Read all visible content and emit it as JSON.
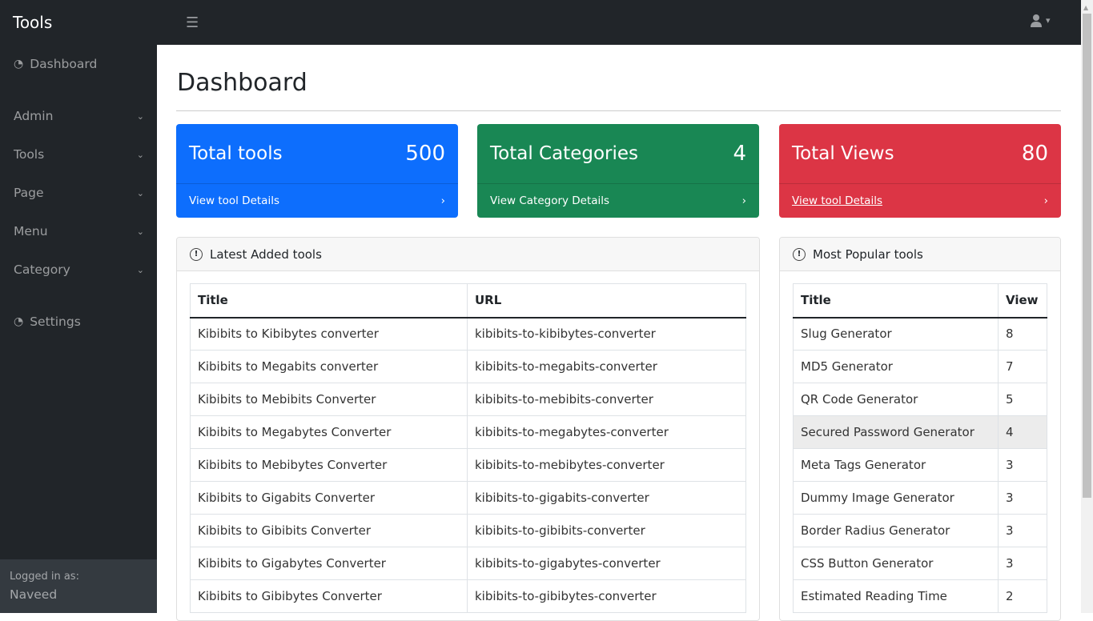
{
  "topbar": {
    "brand": "Tools",
    "menu_icon": "☰",
    "user_icon": "👤",
    "caret": "▾"
  },
  "sidebar": {
    "items": [
      {
        "label": "Dashboard",
        "icon": "gauge-icon"
      },
      {
        "label": "Admin"
      },
      {
        "label": "Tools"
      },
      {
        "label": "Page"
      },
      {
        "label": "Menu"
      },
      {
        "label": "Category"
      },
      {
        "label": "Settings",
        "icon": "gauge-icon"
      }
    ],
    "footer": {
      "label": "Logged in as:",
      "user": "Naveed"
    }
  },
  "page": {
    "title": "Dashboard"
  },
  "cards": [
    {
      "title": "Total tools",
      "value": "500",
      "link": "View tool Details",
      "color": "#0d6efd"
    },
    {
      "title": "Total Categories",
      "value": "4",
      "link": "View Category Details",
      "color": "#198754"
    },
    {
      "title": "Total Views",
      "value": "80",
      "link": "View tool Details",
      "color": "#dc3545"
    }
  ],
  "latest": {
    "title": "Latest Added tools",
    "columns": [
      "Title",
      "URL"
    ],
    "rows": [
      [
        "Kibibits to Kibibytes converter",
        "kibibits-to-kibibytes-converter"
      ],
      [
        "Kibibits to Megabits converter",
        "kibibits-to-megabits-converter"
      ],
      [
        "Kibibits to Mebibits Converter",
        "kibibits-to-mebibits-converter"
      ],
      [
        "Kibibits to Megabytes Converter",
        "kibibits-to-megabytes-converter"
      ],
      [
        "Kibibits to Mebibytes Converter",
        "kibibits-to-mebibytes-converter"
      ],
      [
        "Kibibits to Gigabits Converter",
        "kibibits-to-gigabits-converter"
      ],
      [
        "Kibibits to Gibibits Converter",
        "kibibits-to-gibibits-converter"
      ],
      [
        "Kibibits to Gigabytes Converter",
        "kibibits-to-gigabytes-converter"
      ],
      [
        "Kibibits to Gibibytes Converter",
        "kibibits-to-gibibytes-converter"
      ]
    ]
  },
  "popular": {
    "title": "Most Popular tools",
    "columns": [
      "Title",
      "View"
    ],
    "rows": [
      [
        "Slug Generator",
        "8"
      ],
      [
        "MD5 Generator",
        "7"
      ],
      [
        "QR Code Generator",
        "5"
      ],
      [
        "Secured Password Generator",
        "4"
      ],
      [
        "Meta Tags Generator",
        "3"
      ],
      [
        "Dummy Image Generator",
        "3"
      ],
      [
        "Border Radius Generator",
        "3"
      ],
      [
        "CSS Button Generator",
        "3"
      ],
      [
        "Estimated Reading Time",
        "2"
      ]
    ]
  }
}
